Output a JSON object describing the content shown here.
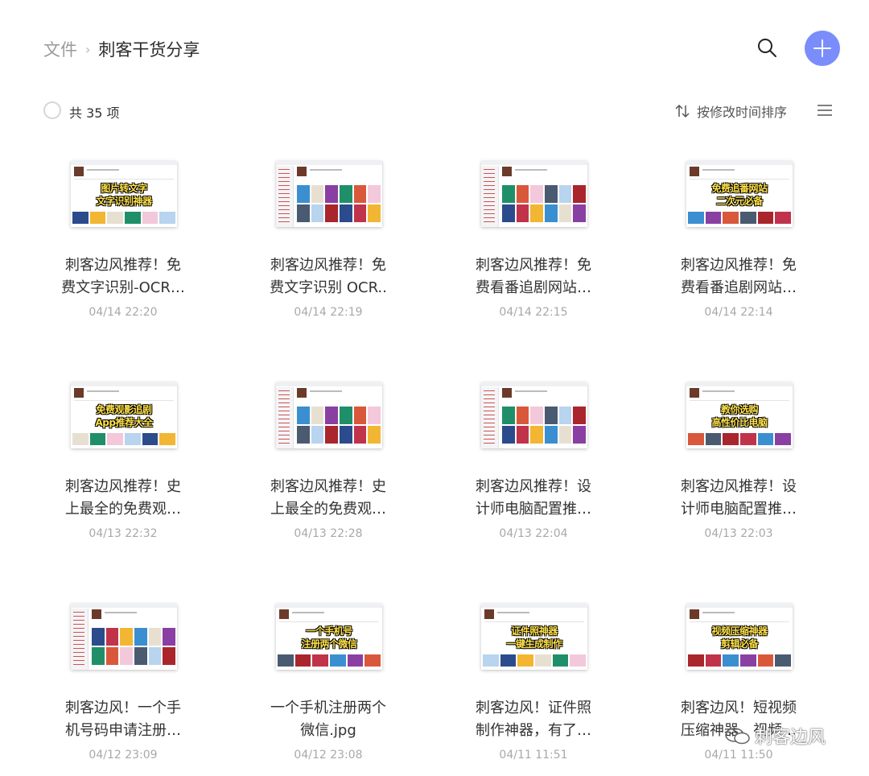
{
  "breadcrumb": {
    "root": "文件",
    "separator": "›",
    "current": "刺客干货分享"
  },
  "header": {
    "search_icon": "search-icon",
    "add_icon": "plus-icon",
    "accent": "#7a8dfb"
  },
  "toolbar": {
    "count": "共 35 项",
    "sort_label": "按修改时间排序"
  },
  "files": [
    {
      "line1": "刺客边风推荐！免",
      "line2": "费文字识别-OCR…",
      "date": "04/14 22:20",
      "thumb": "banner",
      "banner": [
        "图片转文字",
        "文字识别神器"
      ]
    },
    {
      "line1": "刺客边风推荐！免",
      "line2": "费文字识别 OCR..",
      "date": "04/14 22:19",
      "thumb": "screen",
      "banner": []
    },
    {
      "line1": "刺客边风推荐！免",
      "line2": "费看番追剧网站…",
      "date": "04/14 22:15",
      "thumb": "screen",
      "banner": []
    },
    {
      "line1": "刺客边风推荐！免",
      "line2": "费看番追剧网站…",
      "date": "04/14 22:14",
      "thumb": "banner",
      "banner": [
        "免费追番网站",
        "二次元必备"
      ]
    },
    {
      "line1": "刺客边风推荐！史",
      "line2": "上最全的免费观…",
      "date": "04/13 22:32",
      "thumb": "banner",
      "banner": [
        "免费观影追剧",
        "App推荐大全"
      ]
    },
    {
      "line1": "刺客边风推荐！史",
      "line2": "上最全的免费观…",
      "date": "04/13 22:28",
      "thumb": "screen",
      "banner": []
    },
    {
      "line1": "刺客边风推荐！设",
      "line2": "计师电脑配置推…",
      "date": "04/13 22:04",
      "thumb": "screen",
      "banner": []
    },
    {
      "line1": "刺客边风推荐！设",
      "line2": "计师电脑配置推…",
      "date": "04/13 22:03",
      "thumb": "banner",
      "banner": [
        "教你选购",
        "高性价比电脑"
      ]
    },
    {
      "line1": "刺客边风！一个手",
      "line2": "机号码申请注册…",
      "date": "04/12 23:09",
      "thumb": "screen",
      "banner": []
    },
    {
      "line1": "一个手机注册两个",
      "line2": "微信.jpg",
      "date": "04/12 23:08",
      "thumb": "banner",
      "banner": [
        "一个手机号",
        "注册两个微信"
      ]
    },
    {
      "line1": "刺客边风！证件照",
      "line2": "制作神器，有了…",
      "date": "04/11 11:51",
      "thumb": "banner",
      "banner": [
        "证件照神器",
        "一键生成制作"
      ]
    },
    {
      "line1": "刺客边风！短视频",
      "line2": "压缩神器，视频…",
      "date": "04/11 11:50",
      "thumb": "banner",
      "banner": [
        "视频压缩神器",
        "剪辑必备"
      ]
    }
  ],
  "watermark": {
    "text": "刺客边风",
    "icon": "wechat-icon"
  }
}
